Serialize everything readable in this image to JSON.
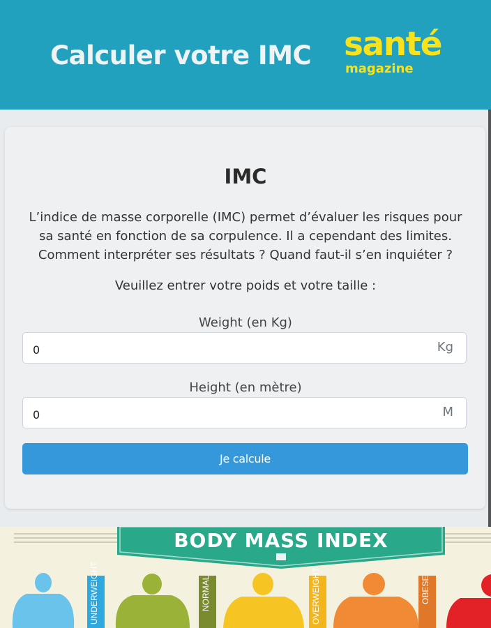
{
  "header": {
    "title": "Calculer votre IMC",
    "logo_main": "santé",
    "logo_sub": "magazine",
    "bg_color": "#22a1be",
    "logo_color": "#f7e21b"
  },
  "card": {
    "title": "IMC",
    "intro": "L’indice de masse corporelle (IMC) permet d’évaluer les risques pour sa santé en fonction de sa corpulence. Il a cependant des limites. Comment interpréter ses résultats ? Quand faut-il s’en inquiéter ?",
    "prompt": "Veuillez entrer votre poids et votre taille :",
    "weight": {
      "label": "Weight (en Kg)",
      "value": "0",
      "unit": "Kg"
    },
    "height": {
      "label": "Height (en mètre)",
      "value": "0",
      "unit": "M"
    },
    "submit_label": "Je calcule",
    "button_color": "#3498db"
  },
  "bmi_image": {
    "title": "BODY MASS INDEX",
    "categories": [
      {
        "label": "UNDERWEIGHT",
        "color": "#2ea8df"
      },
      {
        "label": "NORMAL",
        "color": "#7a8a2f"
      },
      {
        "label": "OVERWEIGHT",
        "color": "#f2b51c"
      },
      {
        "label": "OBESE",
        "color": "#e0782a"
      },
      {
        "label": "",
        "color": "#e32228"
      }
    ]
  }
}
